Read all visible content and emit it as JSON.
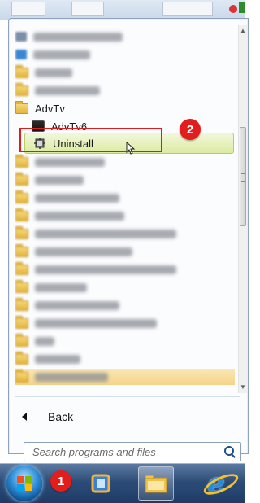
{
  "start_menu": {
    "programs": [
      {
        "label": "",
        "blurred": true,
        "icon": "app-icon"
      },
      {
        "label": "",
        "blurred": true,
        "icon": "app-icon"
      },
      {
        "label": "",
        "blurred": true,
        "icon": "folder-icon"
      },
      {
        "label": "",
        "blurred": true,
        "icon": "folder-icon"
      },
      {
        "label": "AdvTv",
        "icon": "folder-icon"
      },
      {
        "label": "AdvTv6",
        "icon": "app-icon"
      },
      {
        "label": "Uninstall",
        "icon": "uninstall-icon",
        "highlighted": true
      },
      {
        "label": "",
        "blurred": true,
        "icon": "folder-icon"
      }
    ],
    "back_label": "Back",
    "search_placeholder": "Search programs and files"
  },
  "annotations": {
    "badge_1": "1",
    "badge_2": "2"
  },
  "colors": {
    "highlight": "#dbeb9f",
    "annotation_red": "#e31c1c",
    "taskbar": "#2d4d78"
  }
}
